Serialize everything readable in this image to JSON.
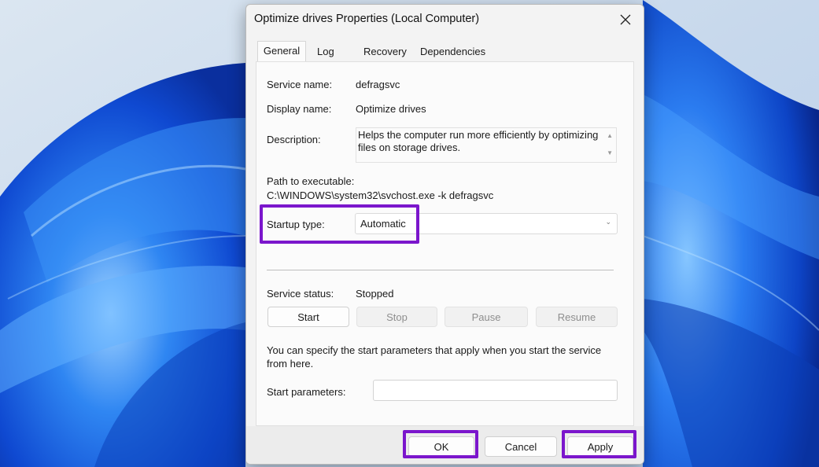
{
  "colors": {
    "highlight": "#7b16cc",
    "dialog_bg": "#f3f3f3",
    "wallpaper_bg": "#c9dbef",
    "wallpaper_accent": "#1a5fe0"
  },
  "dialog": {
    "title": "Optimize drives Properties (Local Computer)",
    "close_icon": "close-icon"
  },
  "tabs": [
    {
      "label": "General",
      "active": true
    },
    {
      "label": "Log On"
    },
    {
      "label": "Recovery"
    },
    {
      "label": "Dependencies"
    }
  ],
  "general": {
    "service_name_label": "Service name:",
    "service_name": "defragsvc",
    "display_name_label": "Display name:",
    "display_name": "Optimize drives",
    "description_label": "Description:",
    "description": "Helps the computer run more efficiently by optimizing files on storage drives.",
    "path_label": "Path to executable:",
    "path": "C:\\WINDOWS\\system32\\svchost.exe -k defragsvc",
    "startup_type_label": "Startup type:",
    "startup_type": "Automatic",
    "service_status_label": "Service status:",
    "service_status": "Stopped",
    "buttons": {
      "start": "Start",
      "stop": "Stop",
      "pause": "Pause",
      "resume": "Resume"
    },
    "info_text": "You can specify the start parameters that apply when you start the service from here.",
    "start_parameters_label": "Start parameters:",
    "start_parameters_value": ""
  },
  "footer": {
    "ok": "OK",
    "cancel": "Cancel",
    "apply": "Apply"
  }
}
